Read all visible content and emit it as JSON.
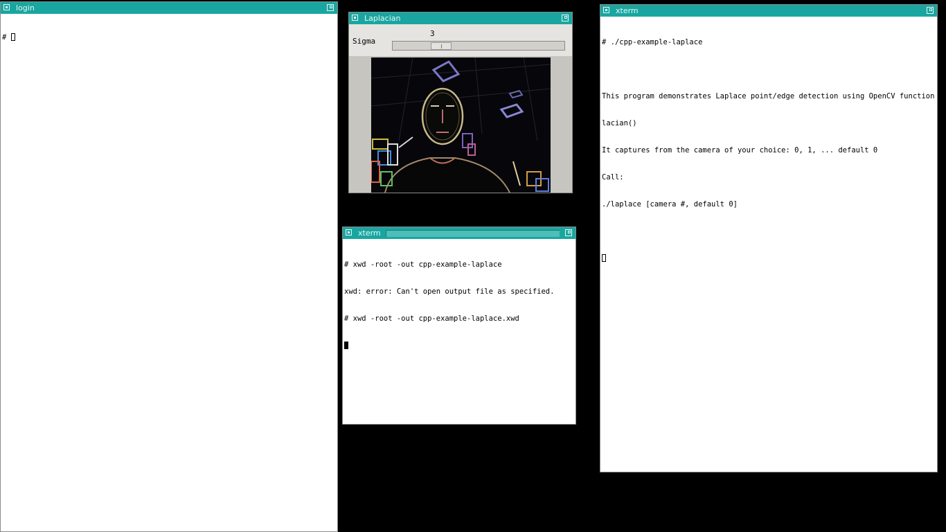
{
  "windows": {
    "login": {
      "title": "login",
      "lines": [
        "# "
      ]
    },
    "laplacian": {
      "title": "Laplacian",
      "trackbar": {
        "label": "Sigma",
        "value": "3",
        "level": 0.25
      }
    },
    "xterm_small": {
      "title": "xterm",
      "lines": [
        "# xwd -root -out cpp-example-laplace",
        "xwd: error: Can't open output file as specified.",
        "# xwd -root -out cpp-example-laplace.xwd"
      ]
    },
    "xterm_right": {
      "title": "xterm",
      "lines": [
        "# ./cpp-example-laplace",
        "",
        "This program demonstrates Laplace point/edge detection using OpenCV function Lap",
        "lacian()",
        "It captures from the camera of your choice: 0, 1, ... default 0",
        "Call:",
        "./laplace [camera #, default 0]"
      ]
    }
  },
  "colors": {
    "titlebar": "#1aa6a0",
    "desktop": "#000000",
    "terminal_bg": "#ffffff"
  },
  "icons": {
    "window_menu": "window-menu-icon",
    "maximize": "maximize-icon"
  }
}
